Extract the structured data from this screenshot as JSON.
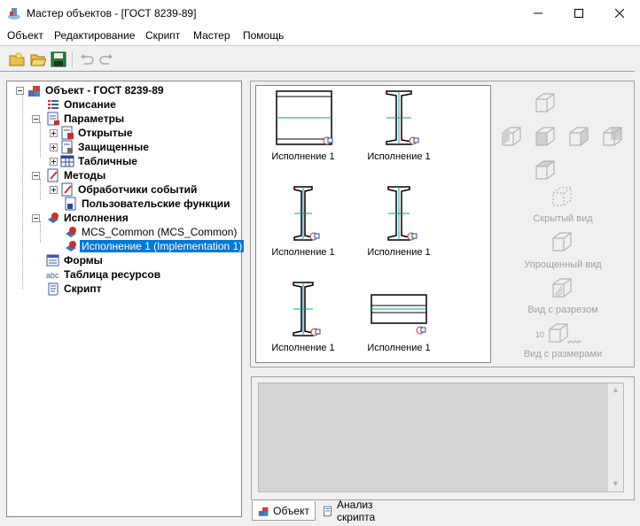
{
  "window": {
    "title": "Мастер объектов - [ГОСТ 8239-89]"
  },
  "menu": [
    "Объект",
    "Редактирование",
    "Скрипт",
    "Мастер",
    "Помощь"
  ],
  "toolbar": {
    "buttons": [
      "new-object-icon",
      "open-folder-icon",
      "save-icon",
      "undo-icon",
      "redo-icon"
    ]
  },
  "tree": {
    "root": "Объект - ГОСТ 8239-89",
    "items": [
      {
        "label": "Описание",
        "bold": true,
        "icon": "list-icon"
      },
      {
        "label": "Параметры",
        "bold": true,
        "icon": "params-icon"
      },
      {
        "label": "Открытые",
        "bold": true,
        "icon": "params-open-icon"
      },
      {
        "label": "Защищенные",
        "bold": true,
        "icon": "params-protected-icon"
      },
      {
        "label": "Табличные",
        "bold": true,
        "icon": "table-icon"
      },
      {
        "label": "Методы",
        "bold": true,
        "icon": "methods-icon"
      },
      {
        "label": "Обработчики событий",
        "bold": true,
        "icon": "event-handlers-icon"
      },
      {
        "label": "Пользовательские функции",
        "bold": true,
        "icon": "user-functions-icon"
      },
      {
        "label": "Исполнения",
        "bold": true,
        "icon": "implementations-icon"
      },
      {
        "label": "MCS_Common (MCS_Common)",
        "bold": false,
        "icon": "implementation-icon"
      },
      {
        "label": "Исполнение 1 (Implementation 1)",
        "bold": false,
        "icon": "implementation-icon",
        "selected": true
      },
      {
        "label": "Формы",
        "bold": true,
        "icon": "forms-icon"
      },
      {
        "label": "Таблица ресурсов",
        "bold": true,
        "icon": "abc-icon"
      },
      {
        "label": "Скрипт",
        "bold": true,
        "icon": "script-icon"
      }
    ]
  },
  "gallery": {
    "items": [
      {
        "caption": "Исполнение 1"
      },
      {
        "caption": "Исполнение 1"
      },
      {
        "caption": "Исполнение 1"
      },
      {
        "caption": "Исполнение 1"
      },
      {
        "caption": "Исполнение 1"
      },
      {
        "caption": "Исполнение 1"
      }
    ]
  },
  "views": {
    "hidden": "Скрытый вид",
    "simplified": "Упрощенный вид",
    "section": "Вид с разрезом",
    "dimensions": "Вид с размерами",
    "dimension_prefix": "10"
  },
  "tabs": {
    "object": "Объект",
    "script_analysis": "Анализ скрипта"
  },
  "colors": {
    "selection": "#0078d7",
    "disabled_text": "#a0a0a0",
    "beam_accent": "#00a0b0"
  }
}
